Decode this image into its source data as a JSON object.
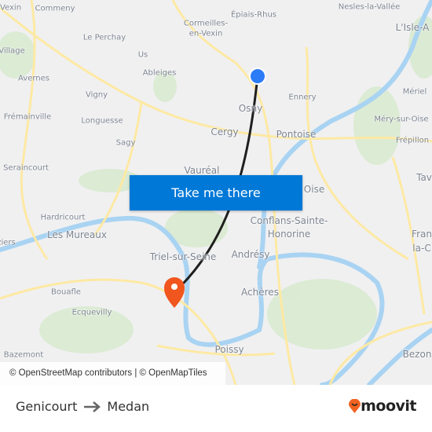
{
  "map": {
    "labels": [
      {
        "text": "-Vexin",
        "size": "s"
      },
      {
        "text": "Commeny",
        "size": "s"
      },
      {
        "text": "Épiais-Rhus",
        "size": "s"
      },
      {
        "text": "Nesles-la-Vallée",
        "size": "s"
      },
      {
        "text": "Cormeilles-",
        "size": "s"
      },
      {
        "text": "en-Vexin",
        "size": "s"
      },
      {
        "text": "L'Isle-A",
        "size": "m"
      },
      {
        "text": "Le Perchay",
        "size": "s"
      },
      {
        "text": "Village",
        "size": "s"
      },
      {
        "text": "Us",
        "size": "s"
      },
      {
        "text": "Ableiges",
        "size": "s"
      },
      {
        "text": "Avernes",
        "size": "s"
      },
      {
        "text": "Ennery",
        "size": "s"
      },
      {
        "text": "Mériel",
        "size": "s"
      },
      {
        "text": "Vigny",
        "size": "s"
      },
      {
        "text": "Osny",
        "size": "m"
      },
      {
        "text": "Frémainville",
        "size": "s"
      },
      {
        "text": "Longuesse",
        "size": "s"
      },
      {
        "text": "Méry-sur-Oise",
        "size": "s"
      },
      {
        "text": "Cergy",
        "size": "m"
      },
      {
        "text": "Pontoise",
        "size": "m"
      },
      {
        "text": "Sagy",
        "size": "s"
      },
      {
        "text": "Frépillon",
        "size": "s"
      },
      {
        "text": "Seraincourt",
        "size": "s"
      },
      {
        "text": "Vauréal",
        "size": "m"
      },
      {
        "text": "Tav",
        "size": "m"
      },
      {
        "text": "Oise",
        "size": "m"
      },
      {
        "text": "Hardricourt",
        "size": "s"
      },
      {
        "text": "Conflans-Sainte-",
        "size": "m"
      },
      {
        "text": "Honorine",
        "size": "m"
      },
      {
        "text": "Les Mureaux",
        "size": "m"
      },
      {
        "text": "ziers",
        "size": "s"
      },
      {
        "text": "Fran",
        "size": "m"
      },
      {
        "text": "la-C",
        "size": "m"
      },
      {
        "text": "Triel-sur-Seine",
        "size": "m"
      },
      {
        "text": "Andrésy",
        "size": "m"
      },
      {
        "text": "Bouafle",
        "size": "s"
      },
      {
        "text": "Achères",
        "size": "m"
      },
      {
        "text": "Ecquevilly",
        "size": "s"
      },
      {
        "text": "Poissy",
        "size": "m"
      },
      {
        "text": "Bazemont",
        "size": "s"
      },
      {
        "text": "Bezon",
        "size": "m"
      }
    ],
    "origin_color": "#2b7cf6",
    "destination_color": "#f0561d",
    "route_color": "#1f1f1f",
    "water_color": "#a9d3f2",
    "road_color": "#fde9a3",
    "park_color": "#d9ead0"
  },
  "cta": {
    "label": "Take me there",
    "color": "#0078d7"
  },
  "attribution": "© OpenStreetMap contributors | © OpenMapTiles",
  "footer": {
    "origin": "Genicourt",
    "destination": "Medan",
    "arrow_icon": "arrow-right-icon",
    "logo": "moovit",
    "logo_color": "#f26322"
  }
}
